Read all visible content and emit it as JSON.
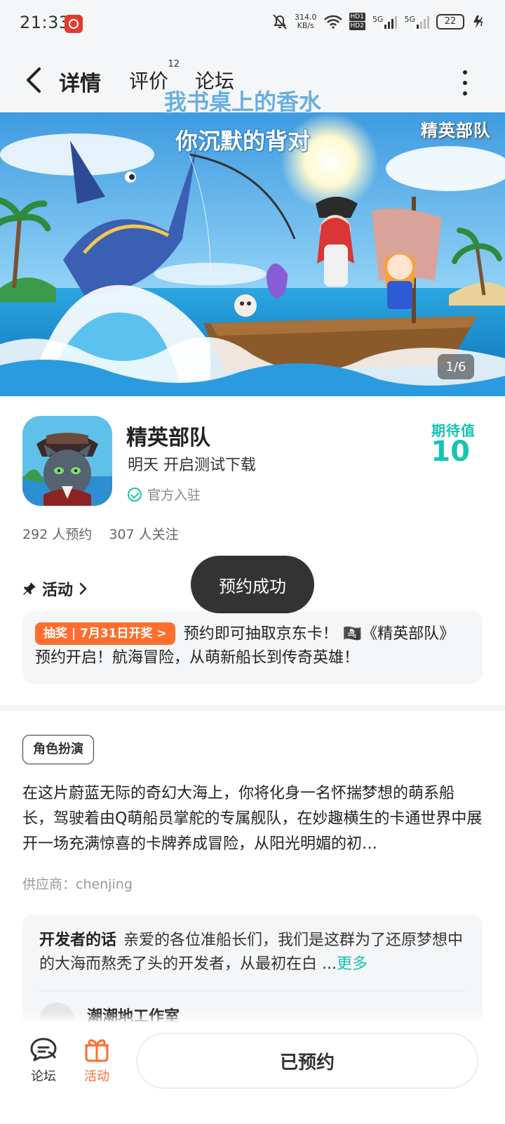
{
  "status_bar": {
    "time": "21:33",
    "net_speed": "314.0",
    "net_unit": "KB/s",
    "hd1": "HD1",
    "hd2": "HD2",
    "sig1": "5G",
    "sig2": "5G",
    "battery": "22"
  },
  "nav": {
    "tabs": [
      {
        "label": "详情",
        "active": true
      },
      {
        "label": "评价",
        "count": "12"
      },
      {
        "label": "论坛"
      }
    ]
  },
  "danmaku": [
    "我书桌上的香水",
    "你沉默的背对"
  ],
  "banner": {
    "watermark": "精英部队",
    "counter": "1/6"
  },
  "game": {
    "name": "精英部队",
    "status": "明天 开启测试下载",
    "official": "官方入驻",
    "expect_label": "期待值",
    "expect_value": "10",
    "reservations": "292 人预约",
    "follows": "307 人关注"
  },
  "activity": {
    "heading": "活动",
    "tag": "抽奖 | 7月31日开奖 >",
    "text": "预约即可抽取京东卡！ 🏴‍☠️《精英部队》预约开启！航海冒险，从萌新船长到传奇英雄！"
  },
  "toast": "预约成功",
  "description": {
    "genre": "角色扮演",
    "text": "在这片蔚蓝无际的奇幻大海上，你将化身一名怀揣梦想的萌系船长，驾驶着由Q萌船员掌舵的专属舰队，在妙趣横生的卡通世界中展开一场充满惊喜的卡牌养成冒险，从阳光明媚的初…",
    "supplier": "供应商：chenjing"
  },
  "developer": {
    "label": "开发者的话",
    "text": "亲爱的各位准船长们，我们是这群为了还原梦想中的大海而熬秃了头的开发者，从最初在白 ...",
    "more": "更多",
    "studio": "潮潮地工作室"
  },
  "bottom_bar": {
    "forum": "论坛",
    "activity": "活动",
    "reserved": "已预约"
  },
  "colors": {
    "accent": "#19c3b3",
    "orange": "#ff6e2f",
    "toast_bg": "#333333"
  }
}
